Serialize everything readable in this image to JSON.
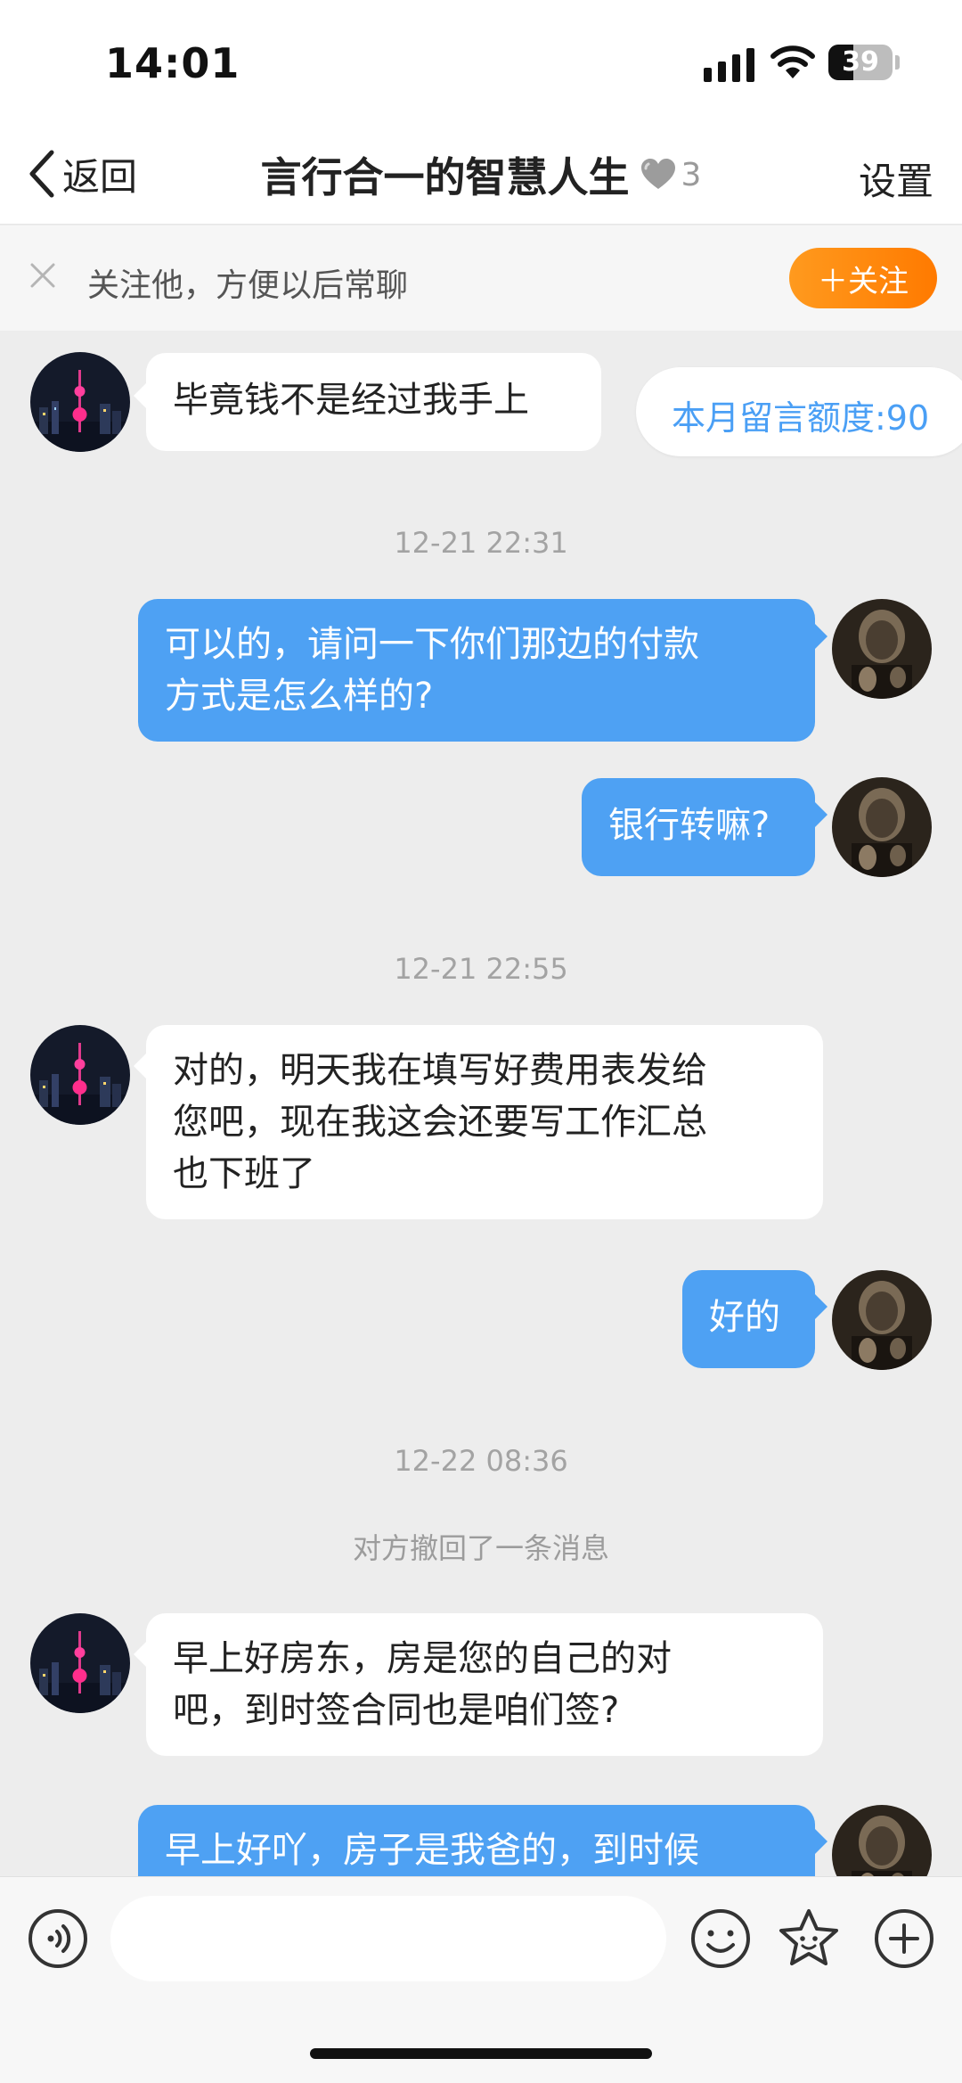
{
  "status_bar": {
    "time": "14:01",
    "battery": "39",
    "battery_level": 0.39
  },
  "nav": {
    "back_label": "返回",
    "title": "言行合一的智慧人生",
    "heart_count": "3",
    "settings_label": "设置"
  },
  "follow_banner": {
    "text": "关注他，方便以后常聊",
    "button_label": "＋关注"
  },
  "quota": {
    "text": "本月留言额度:90"
  },
  "messages": [
    {
      "side": "in",
      "text": "毕竟钱不是经过我手上"
    },
    {
      "type": "time",
      "text": "12-21 22:31"
    },
    {
      "side": "out",
      "lines": [
        "可以的，请问一下你们那边的付款",
        "方式是怎么样的?"
      ]
    },
    {
      "side": "out",
      "text": "银行转嘛?"
    },
    {
      "type": "time",
      "text": "12-21 22:55"
    },
    {
      "side": "in",
      "lines": [
        "对的，明天我在填写好费用表发给",
        "您吧，现在我这会还要写工作汇总",
        "也下班了"
      ]
    },
    {
      "side": "out",
      "text": "好的"
    },
    {
      "type": "time",
      "text": "12-22 08:36"
    },
    {
      "type": "system",
      "text": "对方撤回了一条消息"
    },
    {
      "side": "in",
      "lines": [
        "早上好房东，房是您的自己的对",
        "吧，到时签合同也是咱们签?"
      ]
    },
    {
      "side": "out",
      "text": "早上好吖，房子是我爸的，到时候"
    }
  ],
  "input": {
    "placeholder": ""
  },
  "icons": {
    "voice": "voice-icon",
    "emoji": "emoji-icon",
    "sticker": "star-sticker-icon",
    "add": "plus-circle-icon"
  },
  "colors": {
    "accent_blue": "#4ea1f3",
    "follow_orange": "#ff8a0d",
    "background": "#ededed"
  }
}
